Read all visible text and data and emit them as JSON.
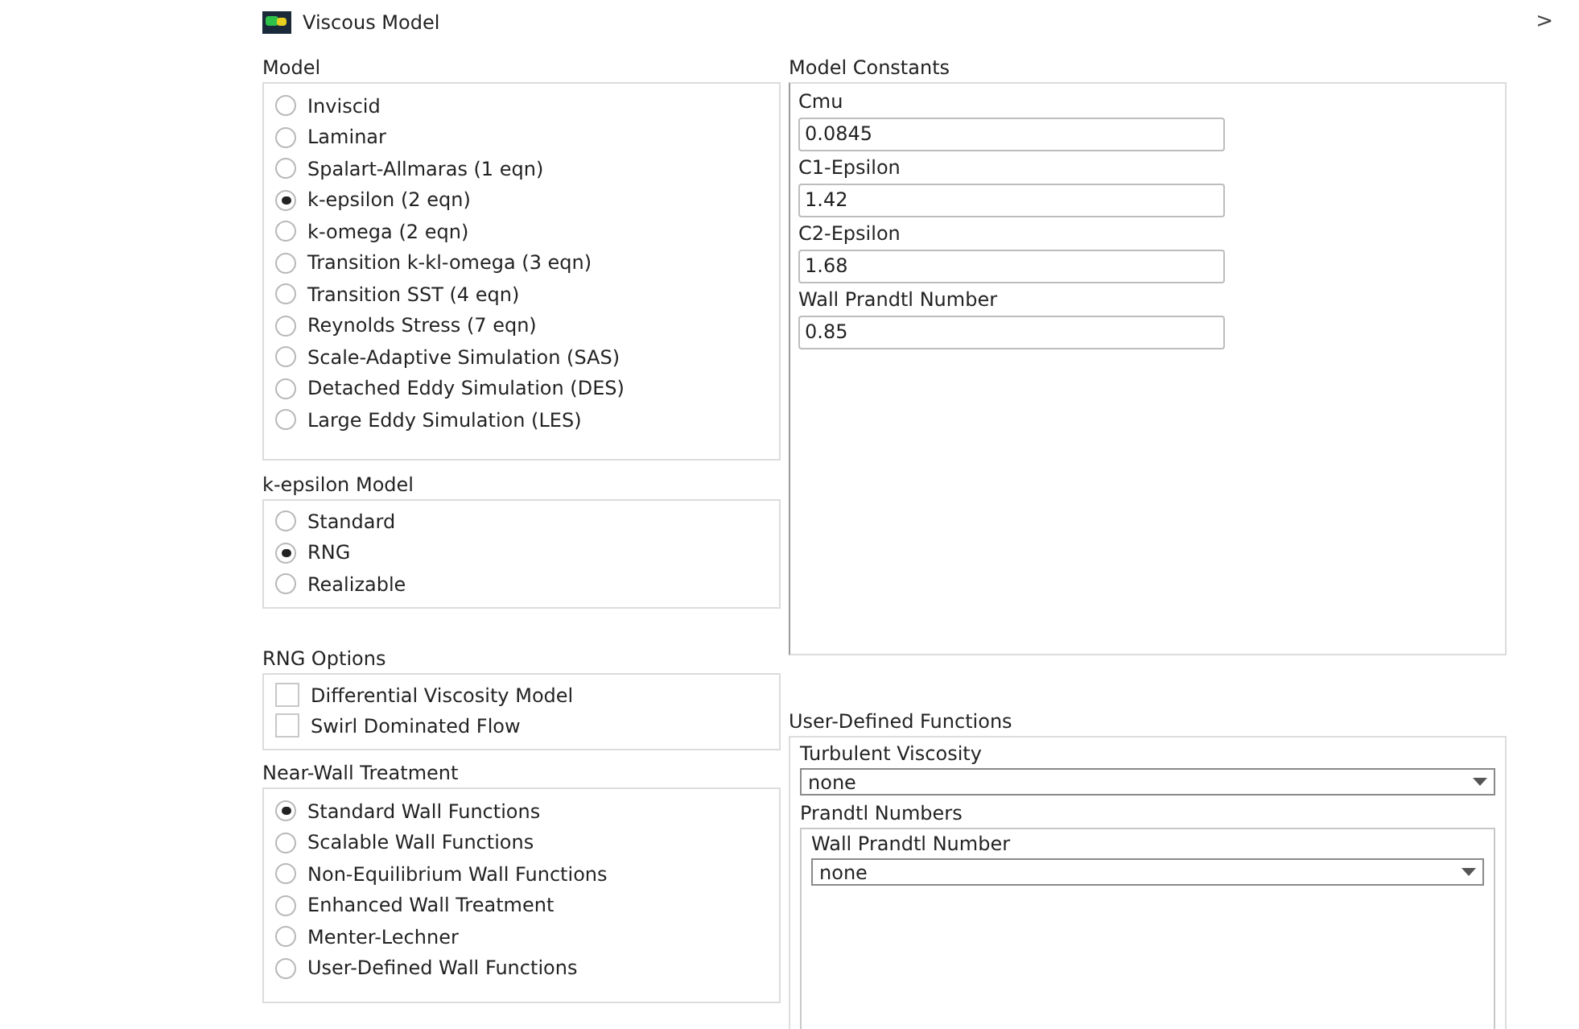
{
  "window": {
    "title": "Viscous Model",
    "close_glyph": ">"
  },
  "model": {
    "label": "Model",
    "options": [
      {
        "label": "Inviscid",
        "selected": false
      },
      {
        "label": "Laminar",
        "selected": false
      },
      {
        "label": "Spalart-Allmaras (1 eqn)",
        "selected": false
      },
      {
        "label": "k-epsilon (2 eqn)",
        "selected": true
      },
      {
        "label": "k-omega (2 eqn)",
        "selected": false
      },
      {
        "label": "Transition k-kl-omega (3 eqn)",
        "selected": false
      },
      {
        "label": "Transition SST (4 eqn)",
        "selected": false
      },
      {
        "label": "Reynolds Stress (7 eqn)",
        "selected": false
      },
      {
        "label": "Scale-Adaptive Simulation (SAS)",
        "selected": false
      },
      {
        "label": "Detached Eddy Simulation (DES)",
        "selected": false
      },
      {
        "label": "Large Eddy Simulation (LES)",
        "selected": false
      }
    ]
  },
  "k_epsilon_model": {
    "label": "k-epsilon Model",
    "options": [
      {
        "label": "Standard",
        "selected": false
      },
      {
        "label": "RNG",
        "selected": true
      },
      {
        "label": "Realizable",
        "selected": false
      }
    ]
  },
  "rng_options": {
    "label": "RNG Options",
    "options": [
      {
        "label": "Differential Viscosity Model",
        "checked": false
      },
      {
        "label": "Swirl Dominated Flow",
        "checked": false
      }
    ]
  },
  "near_wall_treatment": {
    "label": "Near-Wall Treatment",
    "options": [
      {
        "label": "Standard Wall Functions",
        "selected": true
      },
      {
        "label": "Scalable Wall Functions",
        "selected": false
      },
      {
        "label": "Non-Equilibrium Wall Functions",
        "selected": false
      },
      {
        "label": "Enhanced Wall Treatment",
        "selected": false
      },
      {
        "label": "Menter-Lechner",
        "selected": false
      },
      {
        "label": "User-Defined Wall Functions",
        "selected": false
      }
    ]
  },
  "model_constants": {
    "label": "Model Constants",
    "fields": [
      {
        "label": "Cmu",
        "value": "0.0845"
      },
      {
        "label": "C1-Epsilon",
        "value": "1.42"
      },
      {
        "label": "C2-Epsilon",
        "value": "1.68"
      },
      {
        "label": "Wall Prandtl Number",
        "value": "0.85"
      }
    ]
  },
  "user_defined_functions": {
    "label": "User-Defined Functions",
    "turbulent_viscosity": {
      "label": "Turbulent Viscosity",
      "value": "none"
    },
    "prandtl_numbers": {
      "label": "Prandtl Numbers",
      "wall_prandtl_number": {
        "label": "Wall Prandtl Number",
        "value": "none"
      }
    }
  }
}
